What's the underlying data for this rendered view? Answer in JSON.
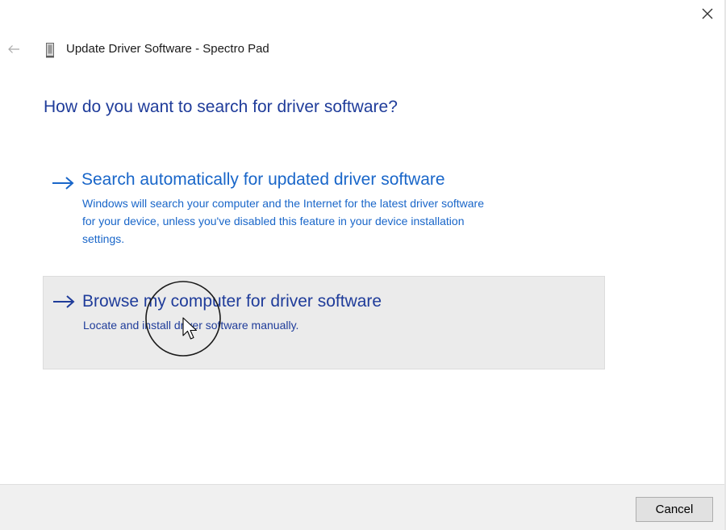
{
  "window": {
    "title": "Update Driver Software - Spectro Pad",
    "close_icon": "close-icon",
    "back_icon": "back-arrow-icon",
    "device_icon": "device-icon"
  },
  "main": {
    "question": "How do you want to search for driver software?",
    "options": [
      {
        "title": "Search automatically for updated driver software",
        "description_lines": [
          "Windows will search your computer and the Internet for the latest driver software",
          "for your device, unless you've disabled this feature in your device installation",
          "settings."
        ],
        "icon": "arrow-right-icon",
        "state": "normal"
      },
      {
        "title": "Browse my computer for driver software",
        "description_lines": [
          "Locate and install driver software manually."
        ],
        "icon": "arrow-right-icon",
        "state": "hover"
      }
    ]
  },
  "footer": {
    "cancel_label": "Cancel"
  },
  "colors": {
    "heading_blue": "#1f3c9a",
    "link_blue": "#1966c9",
    "hover_background": "#ebebeb",
    "footer_background": "#f0f0f0"
  }
}
